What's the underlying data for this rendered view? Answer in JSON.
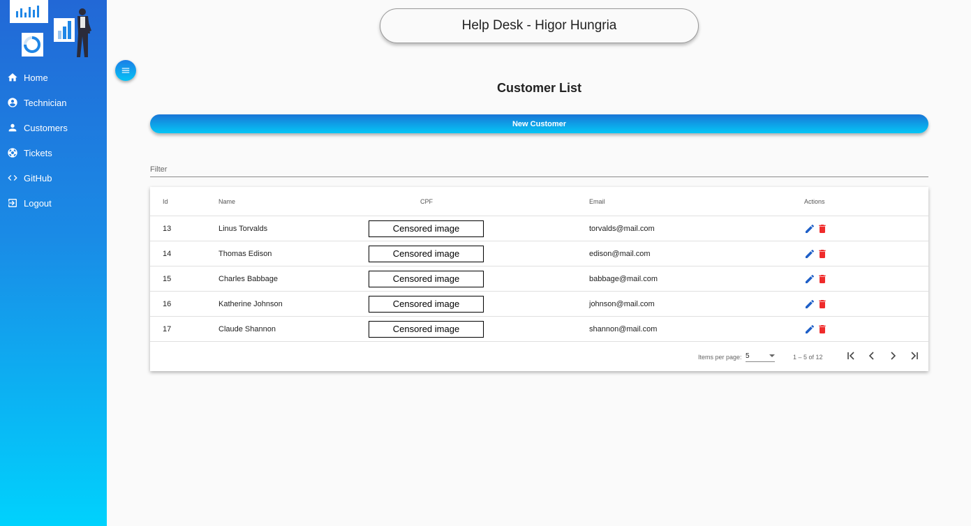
{
  "app": {
    "title": "Help Desk - Higor Hungria"
  },
  "sidebar": {
    "items": [
      {
        "label": "Home",
        "icon": "home-icon"
      },
      {
        "label": "Technician",
        "icon": "account-circle-icon"
      },
      {
        "label": "Customers",
        "icon": "person-icon"
      },
      {
        "label": "Tickets",
        "icon": "lifebuoy-icon"
      },
      {
        "label": "GitHub",
        "icon": "code-icon"
      },
      {
        "label": "Logout",
        "icon": "logout-icon"
      }
    ]
  },
  "main": {
    "page_title": "Customer List",
    "new_button": "New Customer",
    "filter_placeholder": "Filter"
  },
  "table": {
    "headers": {
      "id": "Id",
      "name": "Name",
      "cpf": "CPF",
      "email": "Email",
      "actions": "Actions"
    },
    "rows": [
      {
        "id": "13",
        "name": "Linus Torvalds",
        "cpf": "Censored image",
        "email": "torvalds@mail.com"
      },
      {
        "id": "14",
        "name": "Thomas Edison",
        "cpf": "Censored image",
        "email": "edison@mail.com"
      },
      {
        "id": "15",
        "name": "Charles Babbage",
        "cpf": "Censored image",
        "email": "babbage@mail.com"
      },
      {
        "id": "16",
        "name": "Katherine Johnson",
        "cpf": "Censored image",
        "email": "johnson@mail.com"
      },
      {
        "id": "17",
        "name": "Claude Shannon",
        "cpf": "Censored image",
        "email": "shannon@mail.com"
      }
    ]
  },
  "paginator": {
    "items_per_page_label": "Items per page:",
    "page_size": "5",
    "range": "1 – 5 of 12"
  },
  "colors": {
    "sidebar_top": "#2268d6",
    "sidebar_bottom": "#00d2fd",
    "edit_icon": "#1e5fc8",
    "delete_icon": "#ef2b2b"
  }
}
